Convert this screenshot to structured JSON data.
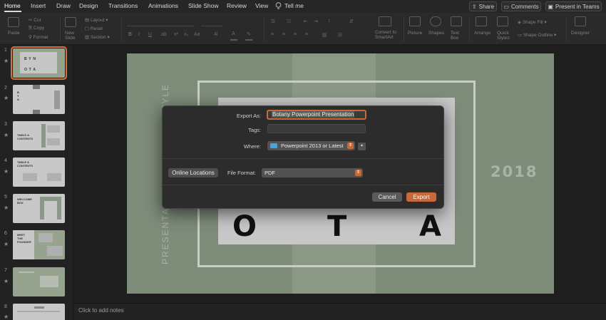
{
  "tabs": [
    {
      "label": "Home"
    },
    {
      "label": "Insert"
    },
    {
      "label": "Draw"
    },
    {
      "label": "Design"
    },
    {
      "label": "Transitions"
    },
    {
      "label": "Animations"
    },
    {
      "label": "Slide Show"
    },
    {
      "label": "Review"
    },
    {
      "label": "View"
    },
    {
      "label": "Tell me"
    }
  ],
  "top_buttons": {
    "share": "Share",
    "comments": "Comments",
    "present": "Present in Teams"
  },
  "ribbon": {
    "paste": "Paste",
    "cut": "Cut",
    "copy": "Copy",
    "format": "Format",
    "new_slide": "New Slide",
    "layout": "Layout",
    "reset": "Reset",
    "section": "Section",
    "convert": "Convert to SmartArt",
    "picture": "Picture",
    "shapes": "Shapes",
    "text_box": "Text Box",
    "arrange": "Arrange",
    "quick_styles": "Quick Styles",
    "shape_fill": "Shape Fill",
    "shape_outline": "Shape Outline",
    "designer": "Designer"
  },
  "thumbnails": [
    {
      "num": "1",
      "text": "B  Y  N\nO  T  A"
    },
    {
      "num": "2",
      "text": "B\nY\nN"
    },
    {
      "num": "3",
      "text": "TABLE &\nCONTENTS"
    },
    {
      "num": "4",
      "text": "TABLE &\nCONTENTS"
    },
    {
      "num": "5",
      "text": "WELCOME\nBOX"
    },
    {
      "num": "6",
      "text": "MEET\nTHE\nFOUNDER"
    },
    {
      "num": "7",
      "text": ""
    },
    {
      "num": "8",
      "text": ""
    }
  ],
  "slide": {
    "letters": [
      "O",
      "T",
      "A"
    ],
    "year": "2018",
    "vertical_text": "PRESENTA",
    "vertical_text_top": "STYLE"
  },
  "notes_placeholder": "Click to add notes",
  "dialog": {
    "export_as_label": "Export As:",
    "export_as_value": "Botany Powerpoint Presentation",
    "tags_label": "Tags:",
    "tags_value": "",
    "where_label": "Where:",
    "where_value": "Powerpoint 2013 or Latest",
    "online_locations": "Online Locations",
    "file_format_label": "File Format:",
    "file_format_value": "PDF",
    "cancel": "Cancel",
    "export": "Export"
  },
  "colors": {
    "accent": "#c8693a",
    "slide_bg": "#7e8c7a",
    "folder": "#4aa3df"
  }
}
